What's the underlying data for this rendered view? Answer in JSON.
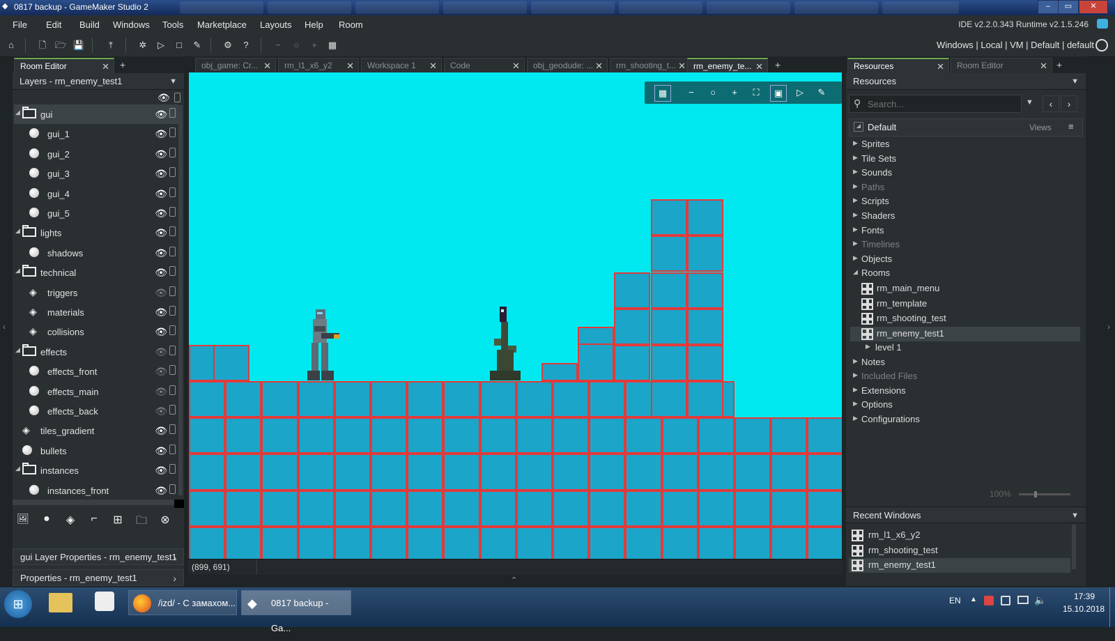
{
  "window": {
    "title": "0817 backup - GameMaker Studio 2",
    "logo": "◆",
    "minimize": "–",
    "maximize": "▭",
    "close": "✕"
  },
  "menu": [
    "File",
    "Edit",
    "Build",
    "Windows",
    "Tools",
    "Marketplace",
    "Layouts",
    "Help",
    "Room"
  ],
  "ide_version": "IDE v2.2.0.343 Runtime v2.1.5.246",
  "target": "Windows | Local | VM | Default | default",
  "toolbar_icons": {
    "home": "⌂",
    "new": "🗋",
    "open": "🗁",
    "save": "💾",
    "export": "⤒",
    "debug": "✲",
    "run": "▷",
    "stop": "□",
    "clean": "✎",
    "settings": "⚙",
    "help": "?",
    "zoom_out": "−",
    "zoom_reset": "○",
    "zoom_in": "+",
    "grid": "▦"
  },
  "left_panel": {
    "tab_label": "Room Editor",
    "tab_close": "✕",
    "tab_add": "+",
    "layers_dropdown": "Layers - rm_enemy_test1",
    "eye_glyph": "👁",
    "layers": [
      {
        "label": "gui",
        "type": "folder",
        "depth": 0,
        "expanded": true,
        "visible": true,
        "selected": true
      },
      {
        "label": "gui_1",
        "type": "instance",
        "depth": 1,
        "visible": true
      },
      {
        "label": "gui_2",
        "type": "instance",
        "depth": 1,
        "visible": true
      },
      {
        "label": "gui_3",
        "type": "instance",
        "depth": 1,
        "visible": true
      },
      {
        "label": "gui_4",
        "type": "instance",
        "depth": 1,
        "visible": true
      },
      {
        "label": "gui_5",
        "type": "instance",
        "depth": 1,
        "visible": true
      },
      {
        "label": "lights",
        "type": "folder",
        "depth": 0,
        "expanded": true,
        "visible": true
      },
      {
        "label": "shadows",
        "type": "instance",
        "depth": 1,
        "visible": true
      },
      {
        "label": "technical",
        "type": "folder",
        "depth": 0,
        "expanded": true,
        "visible": true
      },
      {
        "label": "triggers",
        "type": "tile",
        "depth": 1,
        "visible": false
      },
      {
        "label": "materials",
        "type": "tile",
        "depth": 1,
        "visible": true
      },
      {
        "label": "collisions",
        "type": "tile",
        "depth": 1,
        "visible": true
      },
      {
        "label": "effects",
        "type": "folder",
        "depth": 0,
        "expanded": true,
        "visible": false
      },
      {
        "label": "effects_front",
        "type": "instance",
        "depth": 1,
        "visible": false
      },
      {
        "label": "effects_main",
        "type": "instance",
        "depth": 1,
        "visible": false
      },
      {
        "label": "effects_back",
        "type": "instance",
        "depth": 1,
        "visible": false
      },
      {
        "label": "tiles_gradient",
        "type": "tile",
        "depth": 0,
        "visible": true
      },
      {
        "label": "bullets",
        "type": "instance",
        "depth": 0,
        "visible": true
      },
      {
        "label": "instances",
        "type": "folder",
        "depth": 0,
        "expanded": true,
        "visible": true
      },
      {
        "label": "instances_front",
        "type": "instance",
        "depth": 1,
        "visible": true
      }
    ],
    "layer_tool_icons": [
      "🖼",
      "●",
      "◈",
      "⌐",
      "⊞",
      "🗀",
      "⊗"
    ],
    "gui_layer_properties": "gui Layer Properties - rm_enemy_test1",
    "properties": "Properties - rm_enemy_test1",
    "arrow": "›"
  },
  "editor_tabs": [
    {
      "label": "obj_game: Cr...",
      "active": false
    },
    {
      "label": "rm_l1_x6_y2",
      "active": false
    },
    {
      "label": "Workspace 1",
      "active": false
    },
    {
      "label": "Code",
      "active": false
    },
    {
      "label": "obj_geodude: ...",
      "active": false
    },
    {
      "label": "rm_shooting_t...",
      "active": false
    },
    {
      "label": "rm_enemy_te...",
      "active": true
    }
  ],
  "room_tool_icons": [
    "▦",
    "−",
    "○",
    "+",
    "⛶",
    "▣",
    "▷",
    "✎"
  ],
  "coords": "(899, 691)",
  "collapse_glyph": "⌃",
  "right_panel": {
    "tabs": [
      {
        "label": "Resources",
        "active": true
      },
      {
        "label": "Room Editor",
        "active": false
      }
    ],
    "resources_dropdown": "Resources",
    "search_placeholder": "Search...",
    "search_glyph": "⚲",
    "group_label": "Default",
    "views_label": "Views",
    "tree": [
      {
        "label": "Sprites",
        "dim": false
      },
      {
        "label": "Tile Sets",
        "dim": false
      },
      {
        "label": "Sounds",
        "dim": false
      },
      {
        "label": "Paths",
        "dim": true
      },
      {
        "label": "Scripts",
        "dim": false
      },
      {
        "label": "Shaders",
        "dim": false
      },
      {
        "label": "Fonts",
        "dim": false
      },
      {
        "label": "Timelines",
        "dim": true
      },
      {
        "label": "Objects",
        "dim": false
      },
      {
        "label": "Rooms",
        "dim": false,
        "expanded": true
      }
    ],
    "rooms": [
      "rm_main_menu",
      "rm_template",
      "rm_shooting_test",
      "rm_enemy_test1"
    ],
    "selected_room": "rm_enemy_test1",
    "sub_item": "level 1",
    "tree_after": [
      {
        "label": "Notes",
        "dim": false
      },
      {
        "label": "Included Files",
        "dim": true
      },
      {
        "label": "Extensions",
        "dim": false
      },
      {
        "label": "Options",
        "dim": false
      },
      {
        "label": "Configurations",
        "dim": false
      }
    ],
    "zoom": "100%",
    "recent_windows_title": "Recent Windows",
    "recent_windows": [
      "rm_l1_x6_y2",
      "rm_shooting_test",
      "rm_enemy_test1"
    ]
  },
  "taskbar": {
    "start_glyph": "⊞",
    "tasks": [
      {
        "label": "/izd/ - С замахом...",
        "active": false
      },
      {
        "label": "0817 backup - Ga...",
        "active": true
      }
    ],
    "lang": "EN",
    "time": "17:39",
    "date": "15.10.2018"
  },
  "colors": {
    "room_bg": "#00e9f0",
    "block_fill": "#1ba5c9",
    "block_border": "#e33a3a",
    "accent": "#6aa84f"
  }
}
